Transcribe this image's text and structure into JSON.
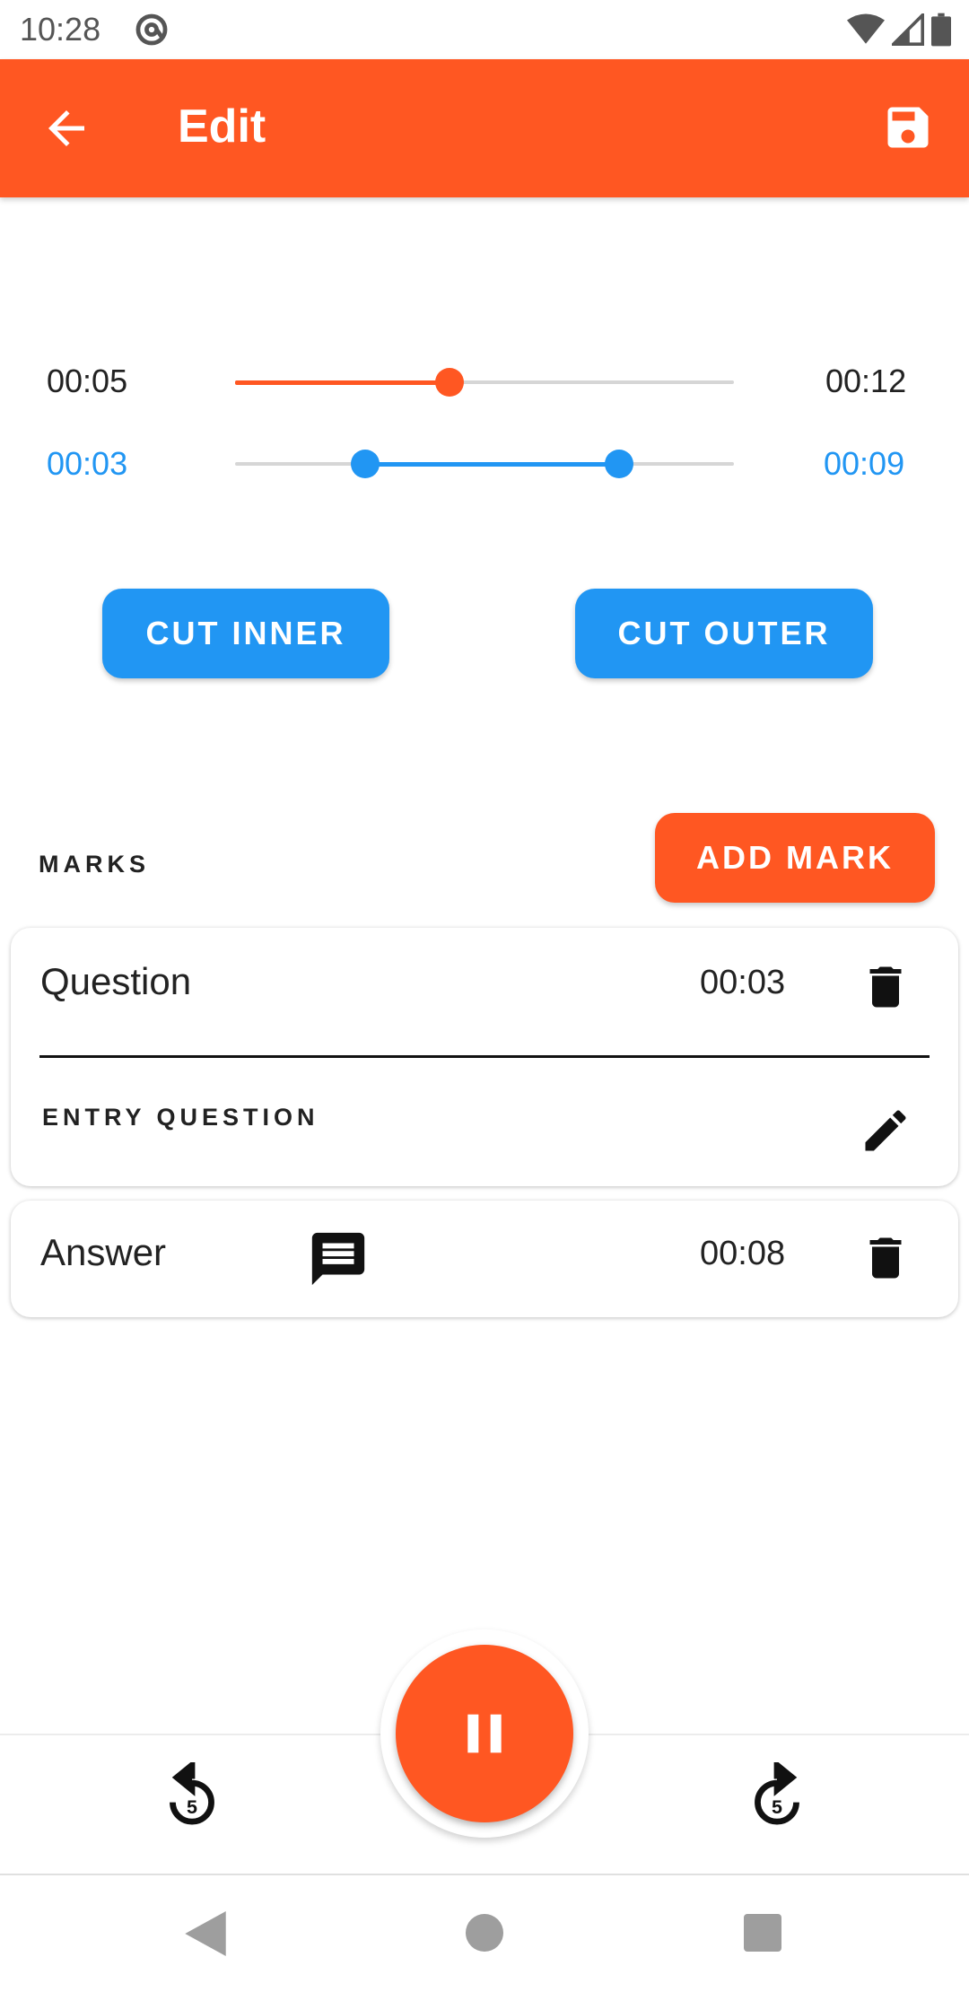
{
  "status_bar": {
    "time": "10:28"
  },
  "app_bar": {
    "title": "Edit",
    "background": "#FF5722"
  },
  "player": {
    "current_time": "00:05",
    "total_time": "00:12",
    "progress_fraction": 0.43
  },
  "range": {
    "start_time": "00:03",
    "end_time": "00:09",
    "start_fraction": 0.26,
    "end_fraction": 0.77,
    "color": "#2196F3"
  },
  "buttons": {
    "cut_inner": "CUT INNER",
    "cut_outer": "CUT OUTER",
    "add_mark": "ADD MARK"
  },
  "marks": {
    "label": "MARKS",
    "items": [
      {
        "title": "Question",
        "time": "00:03",
        "note": "ENTRY QUESTION",
        "icon": "delete-icon"
      },
      {
        "title": "Answer",
        "time": "00:08",
        "icon": "delete-icon",
        "has_comment_icon": true
      }
    ]
  },
  "controls": {
    "rewind_seconds": "5",
    "forward_seconds": "5"
  }
}
